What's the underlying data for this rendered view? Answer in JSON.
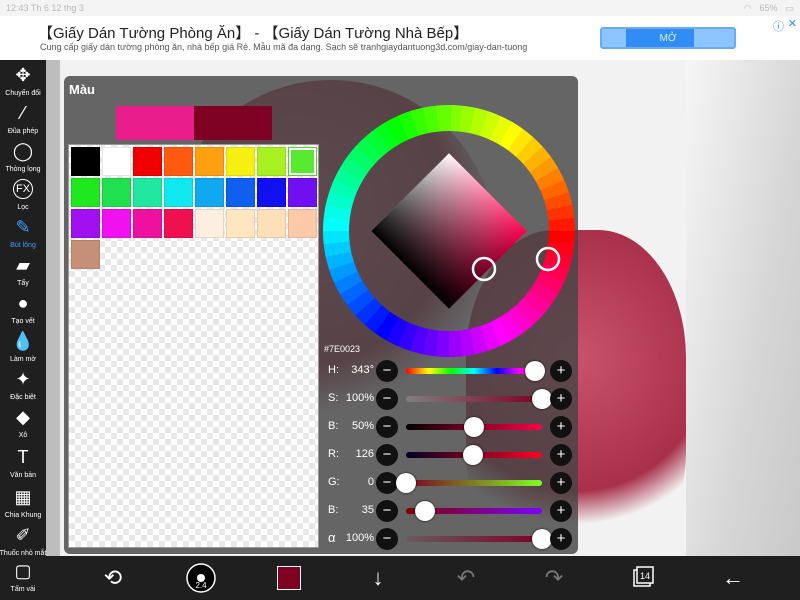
{
  "status_bar": {
    "time": "12:43",
    "date": "Th 6 12 thg 3",
    "battery": "65%"
  },
  "ad": {
    "title": "【Giấy Dán Tường Phòng Ăn】 - 【Giấy Dán Tường Nhà Bếp】",
    "description": "Cung cấp giấy dán tường phòng ăn, nhà bếp giá Rẻ. Mẫu mã đa dạng. Sạch sẽ tranhgiaydantuong3d.com/giay-dan-tuong",
    "button_label": "MỞ",
    "info_icon": "ⓘ",
    "close_icon": "✕"
  },
  "toolbar": {
    "items": [
      {
        "label": "Chuyển đổi",
        "icon": "move-icon",
        "glyph": "✥"
      },
      {
        "label": "Đũa phép",
        "icon": "magic-wand-icon",
        "glyph": "⁄"
      },
      {
        "label": "Thòng lọng",
        "icon": "lasso-icon",
        "glyph": "◯"
      },
      {
        "label": "Lọc",
        "icon": "filter-fx-icon",
        "glyph": "FX"
      },
      {
        "label": "Bút lông",
        "icon": "brush-icon",
        "glyph": "✎",
        "active": true
      },
      {
        "label": "Tẩy",
        "icon": "eraser-icon",
        "glyph": "▰"
      },
      {
        "label": "Tạo vết",
        "icon": "smudge-icon",
        "glyph": "●"
      },
      {
        "label": "Làm mờ",
        "icon": "blur-drop-icon",
        "glyph": "💧"
      },
      {
        "label": "Đặc biệt",
        "icon": "special-effect-icon",
        "glyph": "✦"
      },
      {
        "label": "Xô",
        "icon": "bucket-icon",
        "glyph": "◆"
      },
      {
        "label": "Văn bản",
        "icon": "text-icon",
        "glyph": "T"
      },
      {
        "label": "Chia Khung",
        "icon": "frame-divider-icon",
        "glyph": "▦"
      },
      {
        "label": "Thuốc nhỏ mắt",
        "icon": "eyedropper-icon",
        "glyph": "✐"
      },
      {
        "label": "Tấm vải",
        "icon": "canvas-icon",
        "glyph": "▢"
      }
    ]
  },
  "panel": {
    "title": "Màu",
    "current_color": "#E91E8C",
    "previous_color": "#7E0023",
    "hex_code": "#7E0023",
    "swatches": [
      "#000000",
      "#FFFFFF",
      "#F00000",
      "#FF5A10",
      "#FFA010",
      "#F5F010",
      "#A8F020",
      "#58E830",
      "#20E820",
      "#20E050",
      "#20E8A0",
      "#10E8F0",
      "#10A8F0",
      "#1060F0",
      "#1010F0",
      "#7010F0",
      "#A010F0",
      "#F010F0",
      "#F010A0",
      "#F01050",
      "#FCEFE0",
      "#FDE6C0",
      "#FCE0B8",
      "#FCCAA8",
      "#C49078"
    ],
    "sliders": [
      {
        "key": "H",
        "label": "H:",
        "value": "343°",
        "level": 0.95,
        "kind": "hue"
      },
      {
        "key": "S",
        "label": "S:",
        "value": "100%",
        "level": 1.0,
        "kind": "sat"
      },
      {
        "key": "B",
        "label": "B:",
        "value": "50%",
        "level": 0.5,
        "kind": "bri"
      },
      {
        "key": "R",
        "label": "R:",
        "value": "126",
        "level": 0.494,
        "kind": "red"
      },
      {
        "key": "G",
        "label": "G:",
        "value": "0",
        "level": 0.0,
        "kind": "green"
      },
      {
        "key": "Bl",
        "label": "B:",
        "value": "35",
        "level": 0.137,
        "kind": "blue"
      },
      {
        "key": "A",
        "label": "α",
        "value": "100%",
        "level": 1.0,
        "kind": "alpha"
      }
    ],
    "minus_glyph": "−",
    "plus_glyph": "+"
  },
  "bottom_bar": {
    "brush_size": "2.4",
    "layer_count": "14",
    "color": "#7E0023"
  }
}
